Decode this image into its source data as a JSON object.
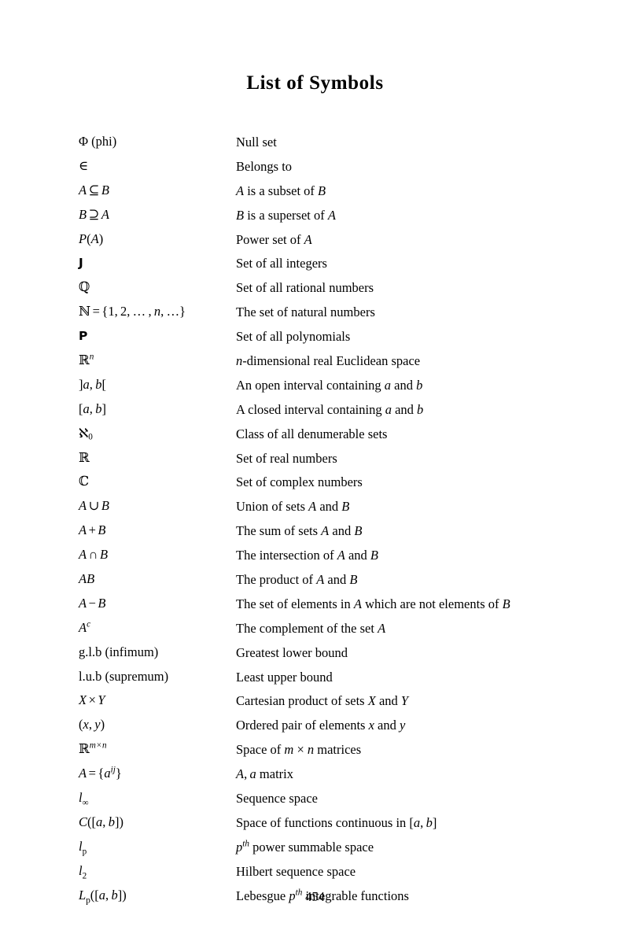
{
  "document": {
    "title": "List of Symbols",
    "page_number": "454"
  },
  "entries": [
    {
      "symbol_text": "Φ (phi)",
      "description_text": "Null set"
    },
    {
      "symbol_text": "∈",
      "description_text": "Belongs to"
    },
    {
      "symbol_text": "A ⊆ B",
      "description_text": "A is a subset of B"
    },
    {
      "symbol_text": "B ⊇ A",
      "description_text": "B is a superset of A"
    },
    {
      "symbol_text": "P(A)",
      "description_text": "Power set of A"
    },
    {
      "symbol_text": "J",
      "description_text": "Set of all integers"
    },
    {
      "symbol_text": "ℚ",
      "description_text": "Set of all rational numbers"
    },
    {
      "symbol_text": "ℕ = {1, 2, … , n, …}",
      "description_text": "The set of natural numbers"
    },
    {
      "symbol_text": "P",
      "description_text": "Set of all polynomials"
    },
    {
      "symbol_text": "ℝⁿ",
      "description_text": "n-dimensional real Euclidean space"
    },
    {
      "symbol_text": "]a, b[",
      "description_text": "An open interval containing a and b"
    },
    {
      "symbol_text": "[a, b]",
      "description_text": "A closed interval containing a and b"
    },
    {
      "symbol_text": "ℵ0",
      "description_text": "Class of all denumerable sets"
    },
    {
      "symbol_text": "ℝ",
      "description_text": "Set of real numbers"
    },
    {
      "symbol_text": "ℂ",
      "description_text": "Set of complex numbers"
    },
    {
      "symbol_text": "A ∪ B",
      "description_text": "Union of sets A and B"
    },
    {
      "symbol_text": "A + B",
      "description_text": "The sum of sets A and B"
    },
    {
      "symbol_text": "A ∩ B",
      "description_text": "The intersection of A and B"
    },
    {
      "symbol_text": "AB",
      "description_text": "The product of A and B"
    },
    {
      "symbol_text": "A − B",
      "description_text": "The set of elements in A which are not elements of B"
    },
    {
      "symbol_text": "Aᶜ",
      "description_text": "The complement of the set A"
    },
    {
      "symbol_text": "g.l.b (infimum)",
      "description_text": "Greatest lower bound"
    },
    {
      "symbol_text": "l.u.b (supremum)",
      "description_text": "Least upper bound"
    },
    {
      "symbol_text": "X × Y",
      "description_text": "Cartesian product of sets X and Y"
    },
    {
      "symbol_text": "(x, y)",
      "description_text": "Ordered pair of elements x and y"
    },
    {
      "symbol_text": "ℝᵐˣⁿ",
      "description_text": "Space of m × n matrices"
    },
    {
      "symbol_text": "A = {aᵢⱼ}",
      "description_text": "A, a matrix"
    },
    {
      "symbol_text": "l∞",
      "description_text": "Sequence space"
    },
    {
      "symbol_text": "C([a, b])",
      "description_text": "Space of functions continuous in [a, b]"
    },
    {
      "symbol_text": "lₚ",
      "description_text": "pᵗʰ power summable space"
    },
    {
      "symbol_text": "l₂",
      "description_text": "Hilbert sequence space"
    },
    {
      "symbol_text": "Lₚ([a, b])",
      "description_text": "Lebesgue pᵗʰ integrable functions"
    }
  ]
}
